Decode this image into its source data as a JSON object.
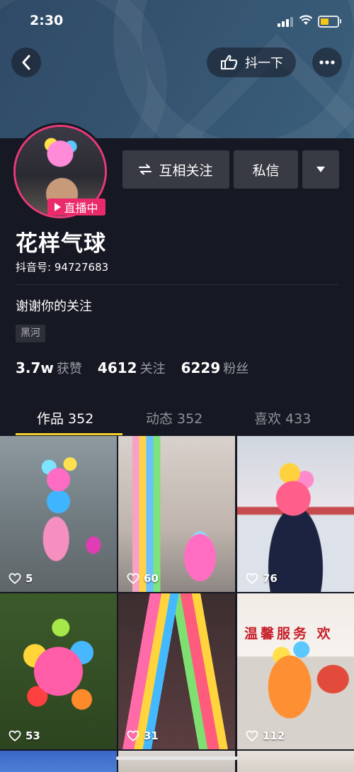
{
  "status_bar": {
    "time": "2:30"
  },
  "header": {
    "shake_label": "抖一下"
  },
  "profile": {
    "live_label": "直播中",
    "follow_label": "互相关注",
    "message_label": "私信",
    "nickname": "花样气球",
    "douyin_id": "抖音号: 94727683",
    "bio": "谢谢你的关注",
    "tag": "黑河",
    "stats": [
      {
        "num": "3.7w",
        "label": "获赞"
      },
      {
        "num": "4612",
        "label": "关注"
      },
      {
        "num": "6229",
        "label": "粉丝"
      }
    ]
  },
  "tabs": [
    {
      "label": "作品 352",
      "active": true
    },
    {
      "label": "动态 352",
      "active": false
    },
    {
      "label": "喜欢 433",
      "active": false
    }
  ],
  "videos": [
    {
      "likes": "5"
    },
    {
      "likes": "60"
    },
    {
      "likes": "76"
    },
    {
      "likes": "53"
    },
    {
      "likes": "31"
    },
    {
      "likes": "112"
    }
  ],
  "video_sign_text": "温馨服务 欢",
  "colors": {
    "background": "#161823",
    "live_badge": "#ea2a6b",
    "tab_underline": "#f3cf2a",
    "button": "#393b44"
  }
}
